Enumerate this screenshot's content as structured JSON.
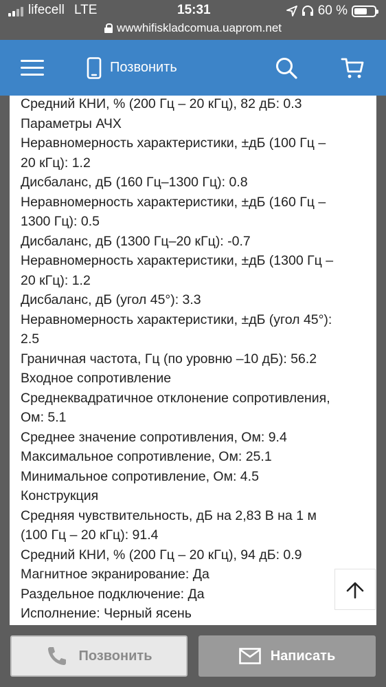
{
  "status_bar": {
    "carrier": "lifecell",
    "network": "LTE",
    "time": "15:31",
    "battery": "60 %",
    "url": "wwwhifiskladcomua.uaprom.net"
  },
  "header": {
    "call_label": "Позвонить",
    "icons": [
      "menu-icon",
      "phone-icon",
      "search-icon",
      "cart-icon"
    ],
    "accent_color": "#3d84c8"
  },
  "specs": [
    "Средний КНИ, % (200 Гц – 20 кГц), 82 дБ: 0.3",
    "Параметры АЧХ",
    "Неравномерность характеристики, ±дБ (100 Гц –",
    "20 кГц): 1.2",
    "Дисбаланс, дБ (160 Гц–1300 Гц): 0.8",
    "Неравномерность характеристики, ±дБ (160 Гц –",
    "1300 Гц): 0.5",
    "Дисбаланс, дБ (1300 Гц–20 кГц): -0.7",
    "Неравномерность характеристики, ±дБ (1300 Гц –",
    "20 кГц): 1.2",
    "Дисбаланс, дБ (угол 45°): 3.3",
    "Неравномерность характеристики, ±дБ (угол 45°):",
    "2.5",
    "Граничная частота, Гц (по уровню –10 дБ): 56.2",
    "Входное сопротивление",
    "Среднеквадратичное отклонение сопротивления,",
    "Ом: 5.1",
    "Среднее значение сопротивления, Ом: 9.4",
    "Максимальное сопротивление, Ом: 25.1",
    "Минимальное сопротивление, Ом: 4.5",
    "Конструкция",
    "Средняя чувствительность, дБ на 2,83 В на 1 м",
    "(100 Гц – 20 кГц): 91.4",
    "Средний КНИ, % (200 Гц – 20 кГц), 94 дБ: 0.9",
    "Магнитное экранирование: Да",
    "Раздельное подключение: Да",
    "Исполнение: Черный ясень"
  ],
  "bottom_bar": {
    "call_label": "Позвонить",
    "write_label": "Написать"
  }
}
